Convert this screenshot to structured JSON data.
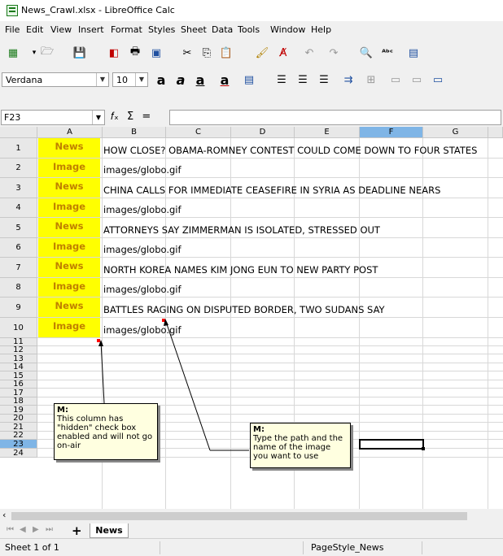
{
  "window": {
    "title": "News_Crawl.xlsx - LibreOffice Calc"
  },
  "menu": [
    "File",
    "Edit",
    "View",
    "Insert",
    "Format",
    "Styles",
    "Sheet",
    "Data",
    "Tools",
    "Window",
    "Help"
  ],
  "format_toolbar": {
    "font_name": "Verdana",
    "font_size": "10"
  },
  "formula_bar": {
    "cell_ref": "F23",
    "content": ""
  },
  "columns": [
    "A",
    "B",
    "C",
    "D",
    "E",
    "F",
    "G"
  ],
  "rows": [
    "1",
    "2",
    "3",
    "4",
    "5",
    "6",
    "7",
    "8",
    "9",
    "10",
    "11",
    "12",
    "13",
    "14",
    "15",
    "16",
    "17",
    "18",
    "19",
    "20",
    "21",
    "22",
    "23",
    "24"
  ],
  "cells": [
    {
      "a": "News",
      "b": "HOW CLOSE? OBAMA-ROMNEY CONTEST COULD COME DOWN TO FOUR STATES"
    },
    {
      "a": "Image",
      "b": "images/globo.gif"
    },
    {
      "a": "News",
      "b": "CHINA CALLS FOR IMMEDIATE CEASEFIRE IN SYRIA AS DEADLINE NEARS"
    },
    {
      "a": "Image",
      "b": "images/globo.gif"
    },
    {
      "a": "News",
      "b": "ATTORNEYS SAY ZIMMERMAN IS ISOLATED, STRESSED OUT"
    },
    {
      "a": "Image",
      "b": "images/globo.gif"
    },
    {
      "a": "News",
      "b": "NORTH KOREA NAMES KIM JONG EUN TO NEW PARTY POST"
    },
    {
      "a": "Image",
      "b": "images/globo.gif"
    },
    {
      "a": "News",
      "b": "BATTLES RAGING ON DISPUTED BORDER, TWO SUDANS SAY"
    },
    {
      "a": "Image",
      "b": "images/globo.gif"
    }
  ],
  "comments": {
    "a": {
      "author": "M:",
      "text": "This column has \"hidden\" check box enabled and will not go on-air"
    },
    "b": {
      "author": "M:",
      "text": "Type the path and the name of the image you want to use"
    }
  },
  "sheet_tab": "News",
  "status": {
    "sheet": "Sheet 1 of 1",
    "page_style": "PageStyle_News"
  },
  "colors": {
    "news_cell_bg": "#ffff00",
    "news_cell_text": "#c08000",
    "selection_header": "#7fb5e6"
  }
}
